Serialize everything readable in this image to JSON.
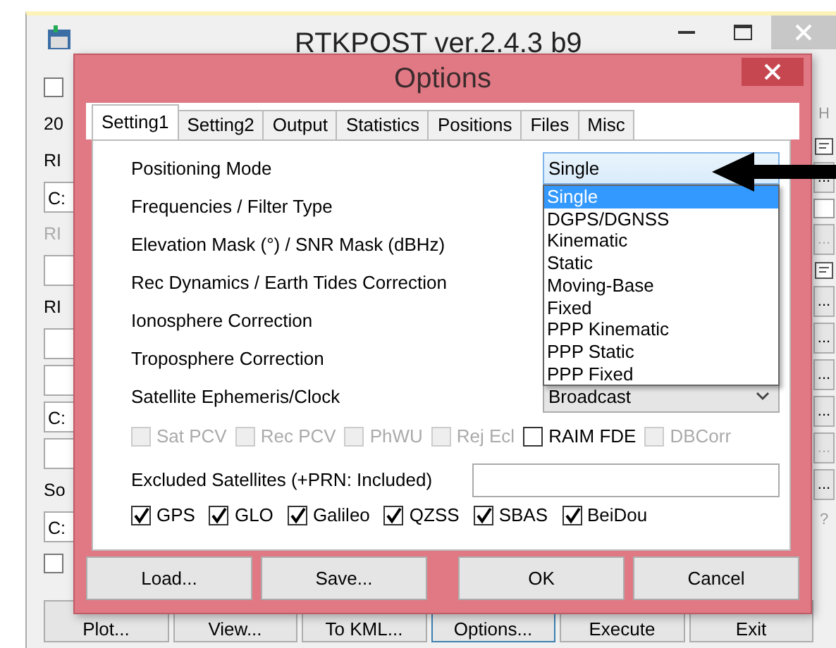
{
  "main_window": {
    "title": "RTKPOST ver.2.4.3 b9",
    "left_strip": [
      {
        "kind": "checkbox",
        "checked": false
      },
      {
        "kind": "text",
        "text": "20"
      },
      {
        "kind": "text",
        "text": "RI",
        "disabled": false
      },
      {
        "kind": "field",
        "text": "C:"
      },
      {
        "kind": "text",
        "text": "RI",
        "disabled": true
      },
      {
        "kind": "field"
      },
      {
        "kind": "text",
        "text": "RI",
        "disabled": false
      },
      {
        "kind": "field"
      },
      {
        "kind": "field"
      },
      {
        "kind": "field",
        "text": "C:"
      },
      {
        "kind": "field"
      },
      {
        "kind": "text",
        "text": "So",
        "disabled": false
      },
      {
        "kind": "field",
        "text": "C:"
      },
      {
        "kind": "checkbox",
        "checked": false
      }
    ],
    "right_strip": [
      {
        "kind": "text",
        "text": "H"
      },
      {
        "kind": "icon"
      },
      {
        "kind": "ellipsis",
        "text": "...",
        "disabled": false
      },
      {
        "kind": "checkbox",
        "checked": false
      },
      {
        "kind": "ellipsis",
        "text": "...",
        "disabled": true
      },
      {
        "kind": "icon"
      },
      {
        "kind": "ellipsis",
        "text": "...",
        "disabled": false
      },
      {
        "kind": "ellipsis",
        "text": "...",
        "disabled": false
      },
      {
        "kind": "ellipsis",
        "text": "...",
        "disabled": false
      },
      {
        "kind": "ellipsis",
        "text": "...",
        "disabled": false
      },
      {
        "kind": "ellipsis",
        "text": "...",
        "disabled": true
      },
      {
        "kind": "ellipsis",
        "text": "...",
        "disabled": false
      },
      {
        "kind": "text",
        "text": "?"
      }
    ],
    "buttons": [
      {
        "label": "Plot...",
        "focused": false
      },
      {
        "label": "View...",
        "focused": false
      },
      {
        "label": "To KML...",
        "focused": false
      },
      {
        "label": "Options...",
        "focused": true
      },
      {
        "label": "Execute",
        "focused": false
      },
      {
        "label": "Exit",
        "focused": false
      }
    ]
  },
  "dialog": {
    "title": "Options",
    "tabs": [
      {
        "label": "Setting1",
        "selected": true
      },
      {
        "label": "Setting2",
        "selected": false
      },
      {
        "label": "Output",
        "selected": false
      },
      {
        "label": "Statistics",
        "selected": false
      },
      {
        "label": "Positions",
        "selected": false
      },
      {
        "label": "Files",
        "selected": false
      },
      {
        "label": "Misc",
        "selected": false
      }
    ],
    "settings": [
      {
        "label": "Positioning Mode",
        "kind": "dropdown",
        "value": "Single",
        "expanded": true,
        "options": [
          {
            "label": "Single",
            "selected": true
          },
          {
            "label": "DGPS/DGNSS",
            "selected": false
          },
          {
            "label": "Kinematic",
            "selected": false
          },
          {
            "label": "Static",
            "selected": false
          },
          {
            "label": "Moving-Base",
            "selected": false
          },
          {
            "label": "Fixed",
            "selected": false
          },
          {
            "label": "PPP Kinematic",
            "selected": false
          },
          {
            "label": "PPP Static",
            "selected": false
          },
          {
            "label": "PPP Fixed",
            "selected": false
          }
        ]
      },
      {
        "label": "Frequencies / Filter Type",
        "kind": "hidden"
      },
      {
        "label": "Elevation Mask (°) / SNR Mask (dBHz)",
        "kind": "hidden"
      },
      {
        "label": "Rec Dynamics / Earth Tides Correction",
        "kind": "hidden"
      },
      {
        "label": "Ionosphere Correction",
        "kind": "hidden"
      },
      {
        "label": "Troposphere Correction",
        "kind": "hidden"
      },
      {
        "label": "Satellite Ephemeris/Clock",
        "kind": "dropdown",
        "value": "Broadcast",
        "expanded": false
      }
    ],
    "corrections": [
      {
        "label": "Sat PCV",
        "checked": false,
        "disabled": true
      },
      {
        "label": "Rec PCV",
        "checked": false,
        "disabled": true
      },
      {
        "label": "PhWU",
        "checked": false,
        "disabled": true
      },
      {
        "label": "Rej Ecl",
        "checked": false,
        "disabled": true
      },
      {
        "label": "RAIM FDE",
        "checked": false,
        "disabled": false
      },
      {
        "label": "DBCorr",
        "checked": false,
        "disabled": true
      }
    ],
    "excluded_satellites": {
      "label": "Excluded Satellites (+PRN: Included)"
    },
    "systems": [
      {
        "label": "GPS",
        "checked": true
      },
      {
        "label": "GLO",
        "checked": true
      },
      {
        "label": "Galileo",
        "checked": true
      },
      {
        "label": "QZSS",
        "checked": true
      },
      {
        "label": "SBAS",
        "checked": true
      },
      {
        "label": "BeiDou",
        "checked": true
      }
    ],
    "buttons": [
      "Load...",
      "Save...",
      "OK",
      "Cancel"
    ]
  }
}
